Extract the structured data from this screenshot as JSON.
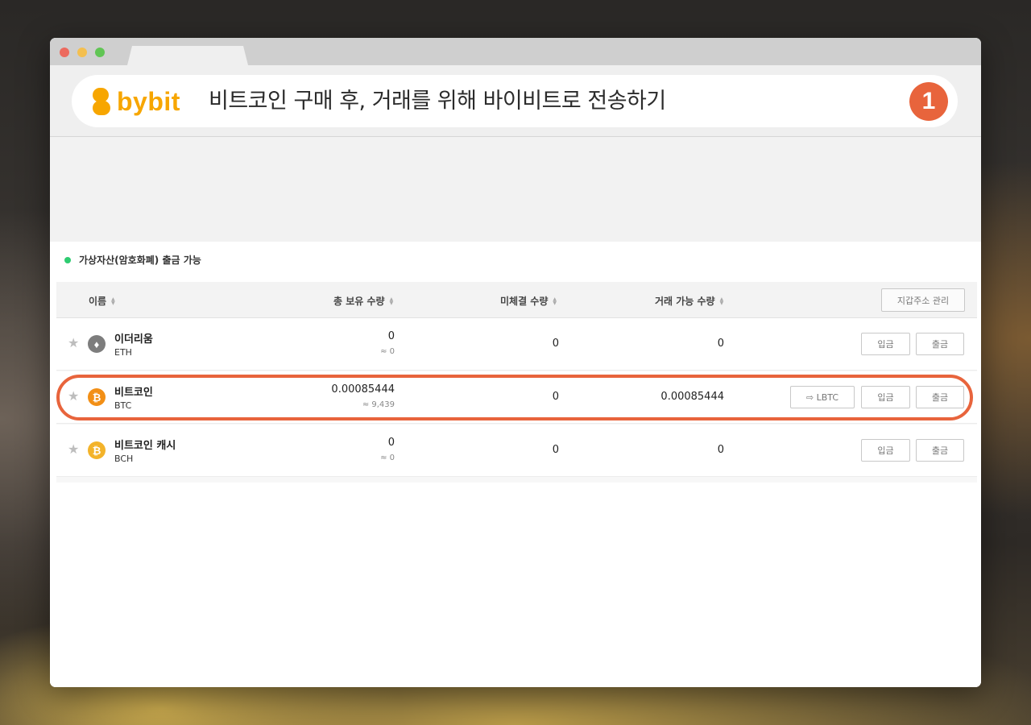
{
  "banner": {
    "logo_text": "bybit",
    "title": "비트코인 구매 후, 거래를 위해 바이비트로 전송하기",
    "step": "1"
  },
  "section": {
    "title": "가상자산(암호화폐) 출금 가능"
  },
  "table": {
    "headers": {
      "name": "이름",
      "total": "총 보유 수량",
      "pending": "미체결 수량",
      "available": "거래 가능 수량"
    },
    "wallet_button": "지갑주소 관리",
    "rows": [
      {
        "name": "이더리움",
        "symbol": "ETH",
        "total": "0",
        "total_krw": "≈ 0",
        "pending": "0",
        "available": "0",
        "deposit": "입금",
        "withdraw": "출금"
      },
      {
        "name": "비트코인",
        "symbol": "BTC",
        "total": "0.00085444",
        "total_krw": "≈ 9,439",
        "pending": "0",
        "available": "0.00085444",
        "lbtc": "⇨ LBTC",
        "deposit": "입금",
        "withdraw": "출금"
      },
      {
        "name": "비트코인 캐시",
        "symbol": "BCH",
        "total": "0",
        "total_krw": "≈ 0",
        "pending": "0",
        "available": "0",
        "deposit": "입금",
        "withdraw": "출금"
      }
    ]
  },
  "colors": {
    "accent": "#e8643c",
    "bybit": "#f7a600",
    "status_green": "#2ecc71"
  }
}
